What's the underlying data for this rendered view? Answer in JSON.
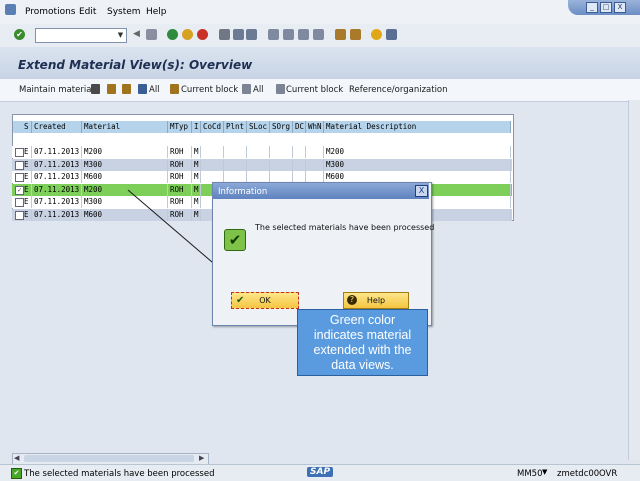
{
  "menu": {
    "items": [
      "Promotions",
      "Edit",
      "System",
      "Help"
    ],
    "underline": [
      "P",
      "E",
      "S",
      "H"
    ]
  },
  "window_controls": [
    "_",
    "□",
    "X"
  ],
  "toolbar": {
    "command_value": "",
    "dropdown_glyph": "▼"
  },
  "title": "Extend Material View(s): Overview",
  "app_toolbar": {
    "maintain": "Maintain materials",
    "all1": "All",
    "current1": "Current block",
    "all2": "All",
    "current2": "Current block",
    "reference": "Reference/organization"
  },
  "table": {
    "columns": [
      "S",
      "Created",
      "Material",
      "MTyp",
      "I",
      "CoCd",
      "Plnt",
      "SLoc",
      "SOrg",
      "DC",
      "WhN",
      "Material Description"
    ],
    "rows": [
      {
        "checked": false,
        "s": "E",
        "created": "07.11.2013",
        "material": "M200",
        "mtyp": "ROH",
        "i": "M",
        "desc": "M200",
        "highlight": "none"
      },
      {
        "checked": false,
        "s": "E",
        "created": "07.11.2013",
        "material": "M300",
        "mtyp": "ROH",
        "i": "M",
        "desc": "M300",
        "highlight": "blue"
      },
      {
        "checked": false,
        "s": "E",
        "created": "07.11.2013",
        "material": "M600",
        "mtyp": "ROH",
        "i": "M",
        "desc": "M600",
        "highlight": "none"
      },
      {
        "checked": true,
        "s": "E",
        "created": "07.11.2013",
        "material": "M200",
        "mtyp": "ROH",
        "i": "M",
        "desc": "",
        "highlight": "green"
      },
      {
        "checked": false,
        "s": "E",
        "created": "07.11.2013",
        "material": "M300",
        "mtyp": "ROH",
        "i": "M",
        "desc": "",
        "highlight": "none"
      },
      {
        "checked": false,
        "s": "E",
        "created": "07.11.2013",
        "material": "M600",
        "mtyp": "ROH",
        "i": "M",
        "desc": "",
        "highlight": "blue"
      }
    ]
  },
  "dialog": {
    "title": "Information",
    "close": "X",
    "message": "The selected materials have been processed",
    "ok": "OK",
    "help": "Help"
  },
  "callout": {
    "line1": "Green color",
    "line2": "indicates material",
    "line3": "extended with the",
    "line4": "data views."
  },
  "status": {
    "message": "The selected materials have been processed",
    "logo": "SAP",
    "tcode": "MM50",
    "host": "zmetdc00",
    "mode": "OVR"
  },
  "colors": {
    "green_row": "#7dcf5a",
    "blue_row": "#c9d2e3",
    "header": "#b5d3ea",
    "callout": "#5a9be0"
  }
}
